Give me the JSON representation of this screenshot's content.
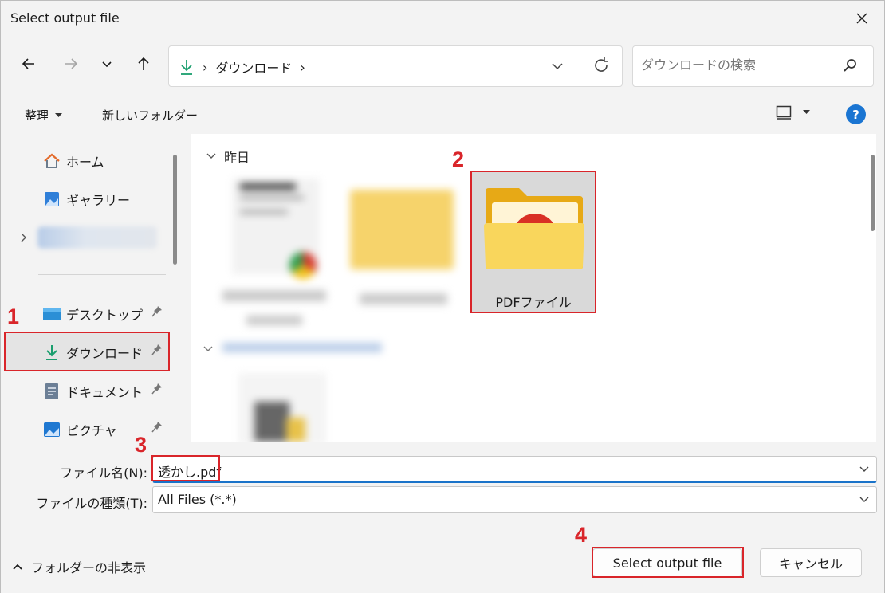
{
  "window": {
    "title": "Select output file"
  },
  "address": {
    "path": [
      "ダウンロード"
    ],
    "search_placeholder": "ダウンロードの検索"
  },
  "commands": {
    "organize": "整理",
    "new_folder": "新しいフォルダー"
  },
  "nav": {
    "home": "ホーム",
    "gallery": "ギャラリー",
    "desktop": "デスクトップ",
    "downloads": "ダウンロード",
    "documents": "ドキュメント",
    "pictures": "ピクチャ"
  },
  "files": {
    "group_label": "昨日",
    "folder_name": "PDFファイル"
  },
  "form": {
    "filename_label": "ファイル名(N):",
    "filename_value": "透かし.pdf",
    "filetype_label": "ファイルの種類(T):",
    "filetype_value": "All Files (*.*)"
  },
  "footer": {
    "hide_folders": "フォルダーの非表示",
    "select_button": "Select output file",
    "cancel_button": "キャンセル"
  },
  "steps": [
    "1",
    "2",
    "3",
    "4"
  ],
  "colors": {
    "highlight": "#d9252a",
    "accent": "#1a75d2",
    "download_green": "#1a9e6e"
  }
}
